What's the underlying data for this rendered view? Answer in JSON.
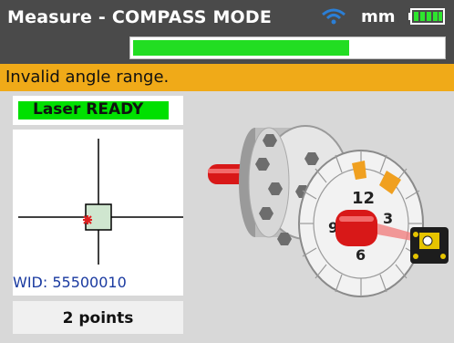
{
  "header": {
    "title": "Measure - COMPASS MODE",
    "unit": "mm",
    "wifi_icon": "wifi-icon",
    "battery_icon": "battery-icon",
    "progress_fraction": 0.7
  },
  "status": {
    "message": "Invalid angle range."
  },
  "laser": {
    "label": "Laser READY",
    "indicator_color": "#00e000"
  },
  "target": {
    "wid_label": "WID: 55500010"
  },
  "points": {
    "label": "2 points"
  },
  "compass": {
    "numbers": [
      "12",
      "3",
      "6",
      "9"
    ]
  },
  "colors": {
    "status_bar": "#f0aa18",
    "title_bar": "#4a4a4a",
    "progress": "#22dd22",
    "laser_ready": "#00e000"
  }
}
